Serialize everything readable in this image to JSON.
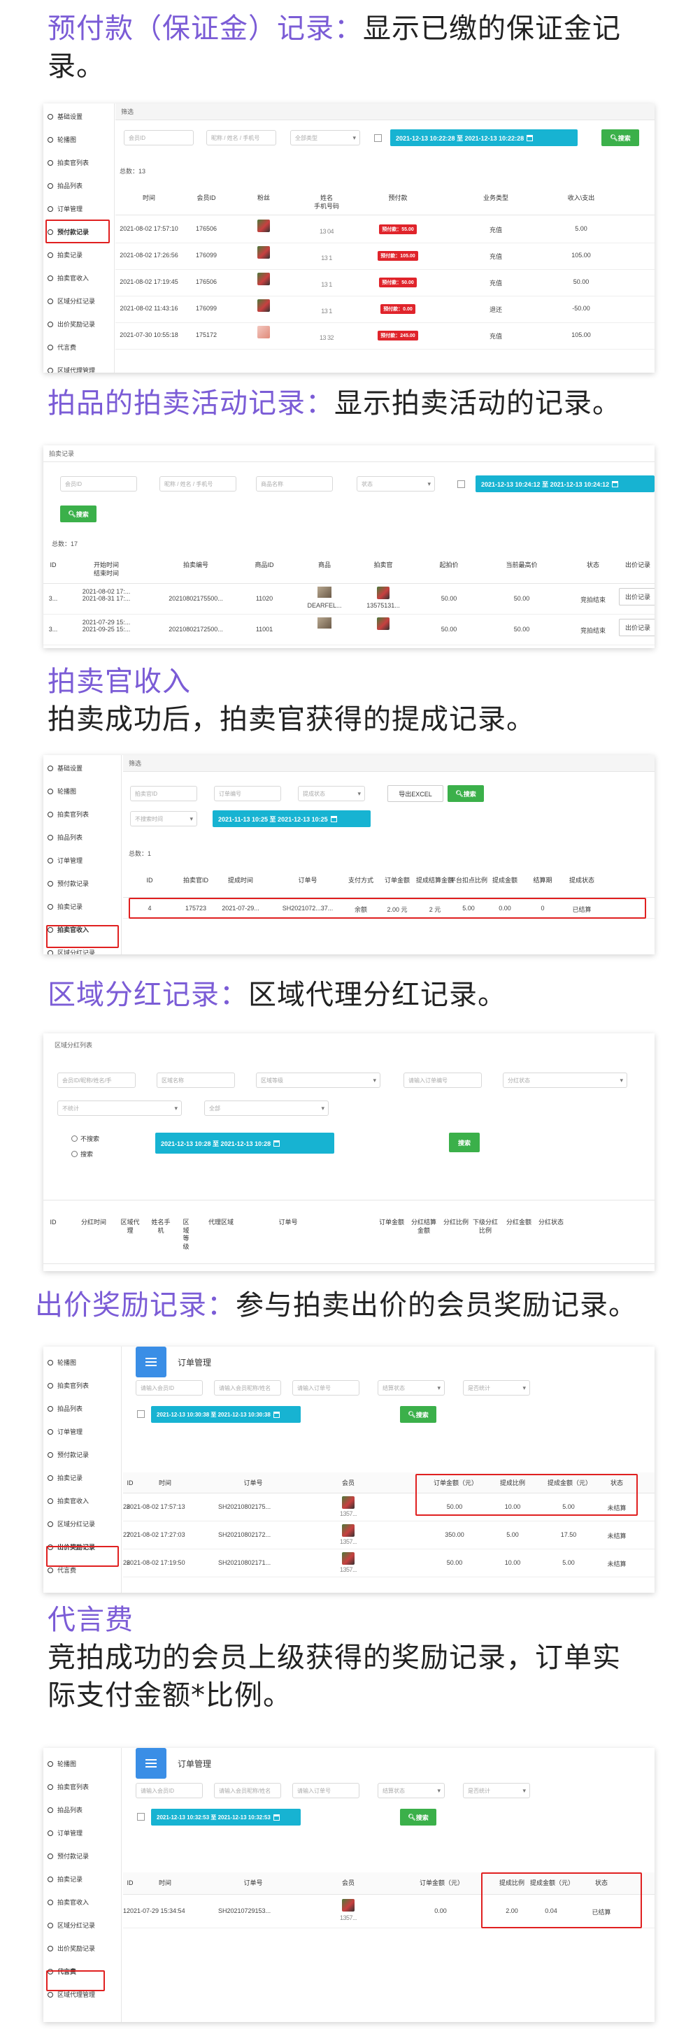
{
  "headings": {
    "s1": {
      "hl": "预付款（保证金）记录：",
      "rest": "显示已缴的保证金记",
      "rest2": "录。"
    },
    "s2": {
      "hl": "拍品的拍卖活动记录：",
      "rest": "显示拍卖活动的记录。"
    },
    "s3": {
      "hl": "拍卖官收入",
      "rest": "拍卖成功后，拍卖官获得的提成记录。"
    },
    "s4": {
      "hl": "区域分红记录：",
      "rest": "区域代理分红记录。"
    },
    "s5": {
      "hl": "出价奖励记录：",
      "rest": "参与拍卖出价的会员奖励记录。"
    },
    "s6": {
      "hl": "代言费",
      "rest": "竞拍成功的会员上级获得的奖励记录，订单实",
      "rest2": "际支付金额*比例。"
    }
  },
  "shot1": {
    "sidebar": [
      "基础设置",
      "轮播图",
      "拍卖官列表",
      "拍品列表",
      "订单管理",
      "预付款记录",
      "拍卖记录",
      "拍卖官收入",
      "区域分红记录",
      "出价奖励记录",
      "代言费",
      "区域代理管理"
    ],
    "filter_label": "筛选",
    "ph_member": "会员ID",
    "ph_name": "昵称 / 姓名 / 手机号",
    "sel_type": "全部类型",
    "date": "2021-12-13 10:22:28 至 2021-12-13 10:22:28",
    "search": "搜索",
    "total": "总数：13",
    "cols": [
      "时间",
      "会员ID",
      "粉丝",
      "姓名\n手机号码",
      "预付款",
      "业务类型",
      "收入\\支出"
    ],
    "rows": [
      {
        "time": "2021-08-02 17:57:10",
        "id": "176506",
        "phone": "13   04",
        "badge": "预付款：55.00",
        "type": "充值",
        "amount": "5.00"
      },
      {
        "time": "2021-08-02 17:26:56",
        "id": "176099",
        "phone": "13   1",
        "badge": "预付款：105.00",
        "type": "充值",
        "amount": "105.00"
      },
      {
        "time": "2021-08-02 17:19:45",
        "id": "176506",
        "phone": "13   1",
        "badge": "预付款：50.00",
        "type": "充值",
        "amount": "50.00"
      },
      {
        "time": "2021-08-02 11:43:16",
        "id": "176099",
        "phone": "13   1",
        "badge": "预付款：0.00",
        "type": "退还",
        "amount": "-50.00"
      },
      {
        "time": "2021-07-30 10:55:18",
        "id": "175172",
        "phone": "13   32",
        "badge": "预付款：245.00",
        "type": "充值",
        "amount": "105.00"
      }
    ]
  },
  "shot2": {
    "title": "拍卖记录",
    "ph_member": "会员ID",
    "ph_name": "昵称 / 姓名 / 手机号",
    "ph_goods": "商品名称",
    "sel_state": "状态",
    "date": "2021-12-13 10:24:12 至 2021-12-13 10:24:12",
    "search": "搜索",
    "total": "总数：17",
    "cols": [
      "ID",
      "开始时间\n结束时间",
      "拍卖编号",
      "商品ID",
      "商品",
      "拍卖官",
      "起拍价",
      "当前最高价",
      "状态",
      "出价记录"
    ],
    "rows": [
      {
        "id": "3...",
        "time": "2021-08-02 17:...\n2021-08-31 17:...",
        "no": "20210802175500...",
        "gid": "11020",
        "goods": "DEARFEL...",
        "officer": "13575131...",
        "start": "50.00",
        "high": "50.00",
        "state": "竞拍结束",
        "btn": "出价记录"
      },
      {
        "id": "3...",
        "time": "2021-07-29 15:...\n2021-09-25 15:...",
        "no": "20210802172500...",
        "gid": "11001",
        "goods": "",
        "officer": "",
        "start": "50.00",
        "high": "50.00",
        "state": "竞拍结束",
        "btn": "出价记录"
      }
    ]
  },
  "shot3": {
    "sidebar": [
      "基础设置",
      "轮播图",
      "拍卖官列表",
      "拍品列表",
      "订单管理",
      "预付款记录",
      "拍卖记录",
      "拍卖官收入",
      "区域分红记录"
    ],
    "filter_label": "筛选",
    "ph_member": "拍卖官ID",
    "ph_order": "订单编号",
    "sel_state": "提成状态",
    "export": "导出EXCEL",
    "search": "搜索",
    "sel_time": "不搜索时间",
    "date": "2021-11-13 10:25 至 2021-12-13 10:25",
    "total": "总数：1",
    "cols": [
      "ID",
      "拍卖官ID",
      "提成时间",
      "订单号",
      "支付方式",
      "订单金额",
      "提成结算金额",
      "平台扣点比例",
      "提成金额",
      "结算期",
      "提成状态"
    ],
    "row": {
      "id": "4",
      "officer": "175723",
      "time": "2021-07-29...",
      "order": "SH2021072...37...",
      "pay": "余额",
      "amount": "2.00 元",
      "settle": "2 元",
      "rate": "5.00",
      "comm": "0.00",
      "period": "0",
      "state": "已结算"
    }
  },
  "shot4": {
    "title": "区域分红列表",
    "ph_member": "会员ID/昵称/姓名/手",
    "ph_area": "区域名称",
    "sel_level": "区域等级",
    "ph_order": "请输入订单编号",
    "sel_state": "分红状态",
    "sel_stat": "不统计",
    "sel_all": "全部",
    "radio_no": "不搜索",
    "radio_yes": "搜索",
    "date": "2021-12-13 10:28 至 2021-12-13 10:28",
    "search": "搜索",
    "cols": [
      "ID",
      "分红时间",
      "区域代理",
      "姓名手机",
      "区域等级",
      "代理区域",
      "订单号",
      "订单金额",
      "分红结算金额",
      "分红比例",
      "下级分红比例",
      "分红金额",
      "分红状态"
    ]
  },
  "shot5": {
    "sidebar": [
      "轮播图",
      "拍卖官列表",
      "拍品列表",
      "订单管理",
      "预付款记录",
      "拍卖记录",
      "拍卖官收入",
      "区域分红记录",
      "出价奖励记录",
      "代言费"
    ],
    "mgmt": "订单管理",
    "ph_member": "请输入会员ID",
    "ph_name": "请输入会员昵称/姓名",
    "ph_order": "请输入订单号",
    "sel_state": "结算状态",
    "sel_stat": "是否统计",
    "date": "2021-12-13 10:30:38 至 2021-12-13 10:30:38",
    "search": "搜索",
    "cols": [
      "ID",
      "时间",
      "订单号",
      "会员",
      "订单金额（元）",
      "提成比例",
      "提成金额（元）",
      "状态"
    ],
    "rows": [
      {
        "id": "28",
        "time": "2021-08-02 17:57:13",
        "order": "SH20210802175...",
        "member": "1357...",
        "amount": "50.00",
        "rate": "10.00",
        "comm": "5.00",
        "state": "未结算"
      },
      {
        "id": "27",
        "time": "2021-08-02 17:27:03",
        "order": "SH20210802172...",
        "member": "1357...",
        "amount": "350.00",
        "rate": "5.00",
        "comm": "17.50",
        "state": "未结算"
      },
      {
        "id": "26",
        "time": "2021-08-02 17:19:50",
        "order": "SH20210802171...",
        "member": "1357...",
        "amount": "50.00",
        "rate": "10.00",
        "comm": "5.00",
        "state": "未结算"
      }
    ]
  },
  "shot6": {
    "sidebar": [
      "轮播图",
      "拍卖官列表",
      "拍品列表",
      "订单管理",
      "预付款记录",
      "拍卖记录",
      "拍卖官收入",
      "区域分红记录",
      "出价奖励记录",
      "代言费",
      "区域代理管理"
    ],
    "mgmt": "订单管理",
    "ph_member": "请输入会员ID",
    "ph_name": "请输入会员昵称/姓名",
    "ph_order": "请输入订单号",
    "sel_state": "结算状态",
    "sel_stat": "是否统计",
    "date": "2021-12-13 10:32:53 至 2021-12-13 10:32:53",
    "search": "搜索",
    "cols": [
      "ID",
      "时间",
      "订单号",
      "会员",
      "订单金额（元）",
      "提成比例",
      "提成金额（元）",
      "状态"
    ],
    "row": {
      "id": "1",
      "time": "2021-07-29 15:34:54",
      "order": "SH20210729153...",
      "member": "1357...",
      "amount": "0.00",
      "rate": "2.00",
      "comm": "0.04",
      "state": "已结算"
    }
  },
  "colors": {
    "accent": "#7b5cd6",
    "date_btn": "#17b3d2",
    "search_btn": "#3bb04a",
    "badge": "#e0242b",
    "highlight": "#e02020"
  }
}
